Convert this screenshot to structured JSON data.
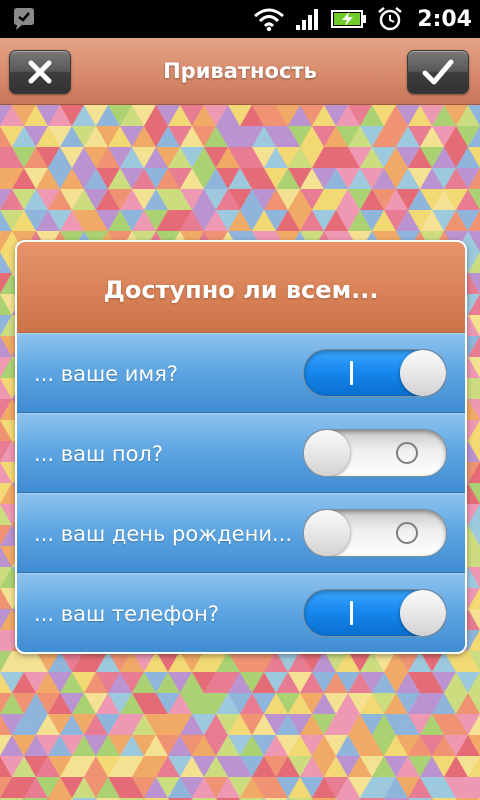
{
  "status_bar": {
    "time": "2:04",
    "icons": [
      "app-notification-icon",
      "wifi-icon",
      "signal-icon",
      "battery-charging-icon",
      "alarm-clock-icon"
    ]
  },
  "title_bar": {
    "title": "Приватность",
    "cancel_icon": "close-icon",
    "confirm_icon": "checkmark-icon"
  },
  "dialog": {
    "heading": "Доступно ли всем...",
    "items": [
      {
        "label": "... ваше имя?",
        "enabled": true
      },
      {
        "label": "... ваш пол?",
        "enabled": false
      },
      {
        "label": "... ваш день рождени...",
        "enabled": false
      },
      {
        "label": "... ваш телефон?",
        "enabled": true
      }
    ]
  },
  "colors": {
    "title_bar": "#d98d6d",
    "dialog_header": "#d98257",
    "row_blue": "#5fa7e3",
    "toggle_on": "#1585ea",
    "toggle_off": "#efefef"
  }
}
